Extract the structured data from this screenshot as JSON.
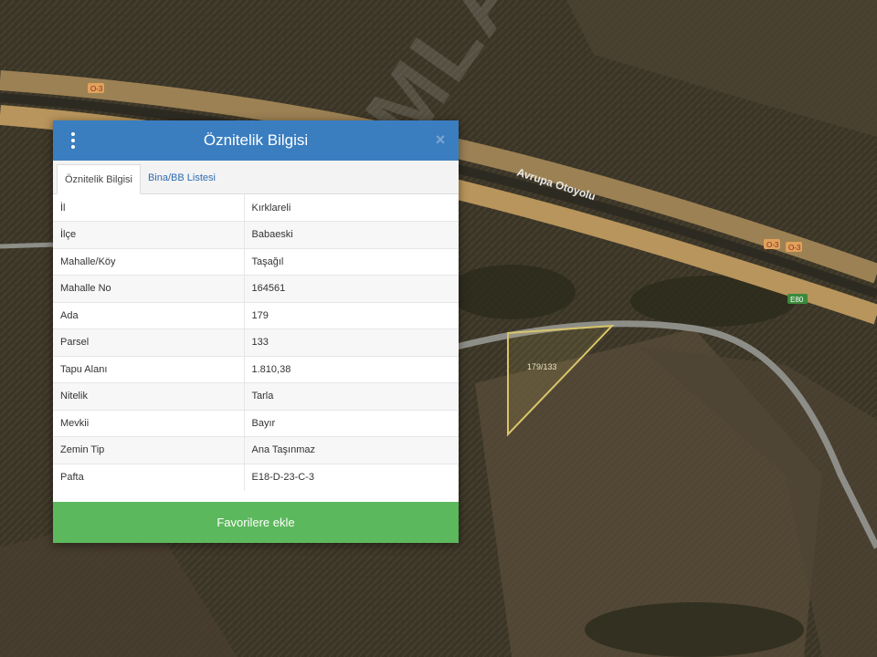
{
  "map": {
    "road_name": "Avrupa Otoyolu",
    "road_codes": [
      "O-3",
      "O-3",
      "O-3",
      "O-3",
      "E80"
    ],
    "parcel_label": "179/133",
    "watermark": "EMLAKGYO",
    "colors": {
      "background": "#3b3527",
      "highway": "#b8955c",
      "parcel_outline": "#d8c56a",
      "side_road": "#8e8e88"
    }
  },
  "panel": {
    "title": "Öznitelik Bilgisi",
    "menu_icon": "vertical-ellipsis-icon",
    "close_icon": "close-icon",
    "tabs": [
      {
        "label": "Öznitelik Bilgisi",
        "active": true
      },
      {
        "label": "Bina/BB Listesi",
        "active": false
      }
    ],
    "rows": [
      {
        "key": "İl",
        "value": "Kırklareli"
      },
      {
        "key": "İlçe",
        "value": "Babaeski"
      },
      {
        "key": "Mahalle/Köy",
        "value": "Taşağıl"
      },
      {
        "key": "Mahalle No",
        "value": "164561"
      },
      {
        "key": "Ada",
        "value": "179"
      },
      {
        "key": "Parsel",
        "value": "133"
      },
      {
        "key": "Tapu Alanı",
        "value": "1.810,38"
      },
      {
        "key": "Nitelik",
        "value": "Tarla"
      },
      {
        "key": "Mevkii",
        "value": "Bayır"
      },
      {
        "key": "Zemin Tip",
        "value": "Ana Taşınmaz"
      },
      {
        "key": "Pafta",
        "value": "E18-D-23-C-3"
      }
    ],
    "favorite_button": "Favorilere ekle",
    "colors": {
      "header": "#3a7ec0",
      "button": "#5cb85c",
      "link": "#2e6db2"
    }
  }
}
